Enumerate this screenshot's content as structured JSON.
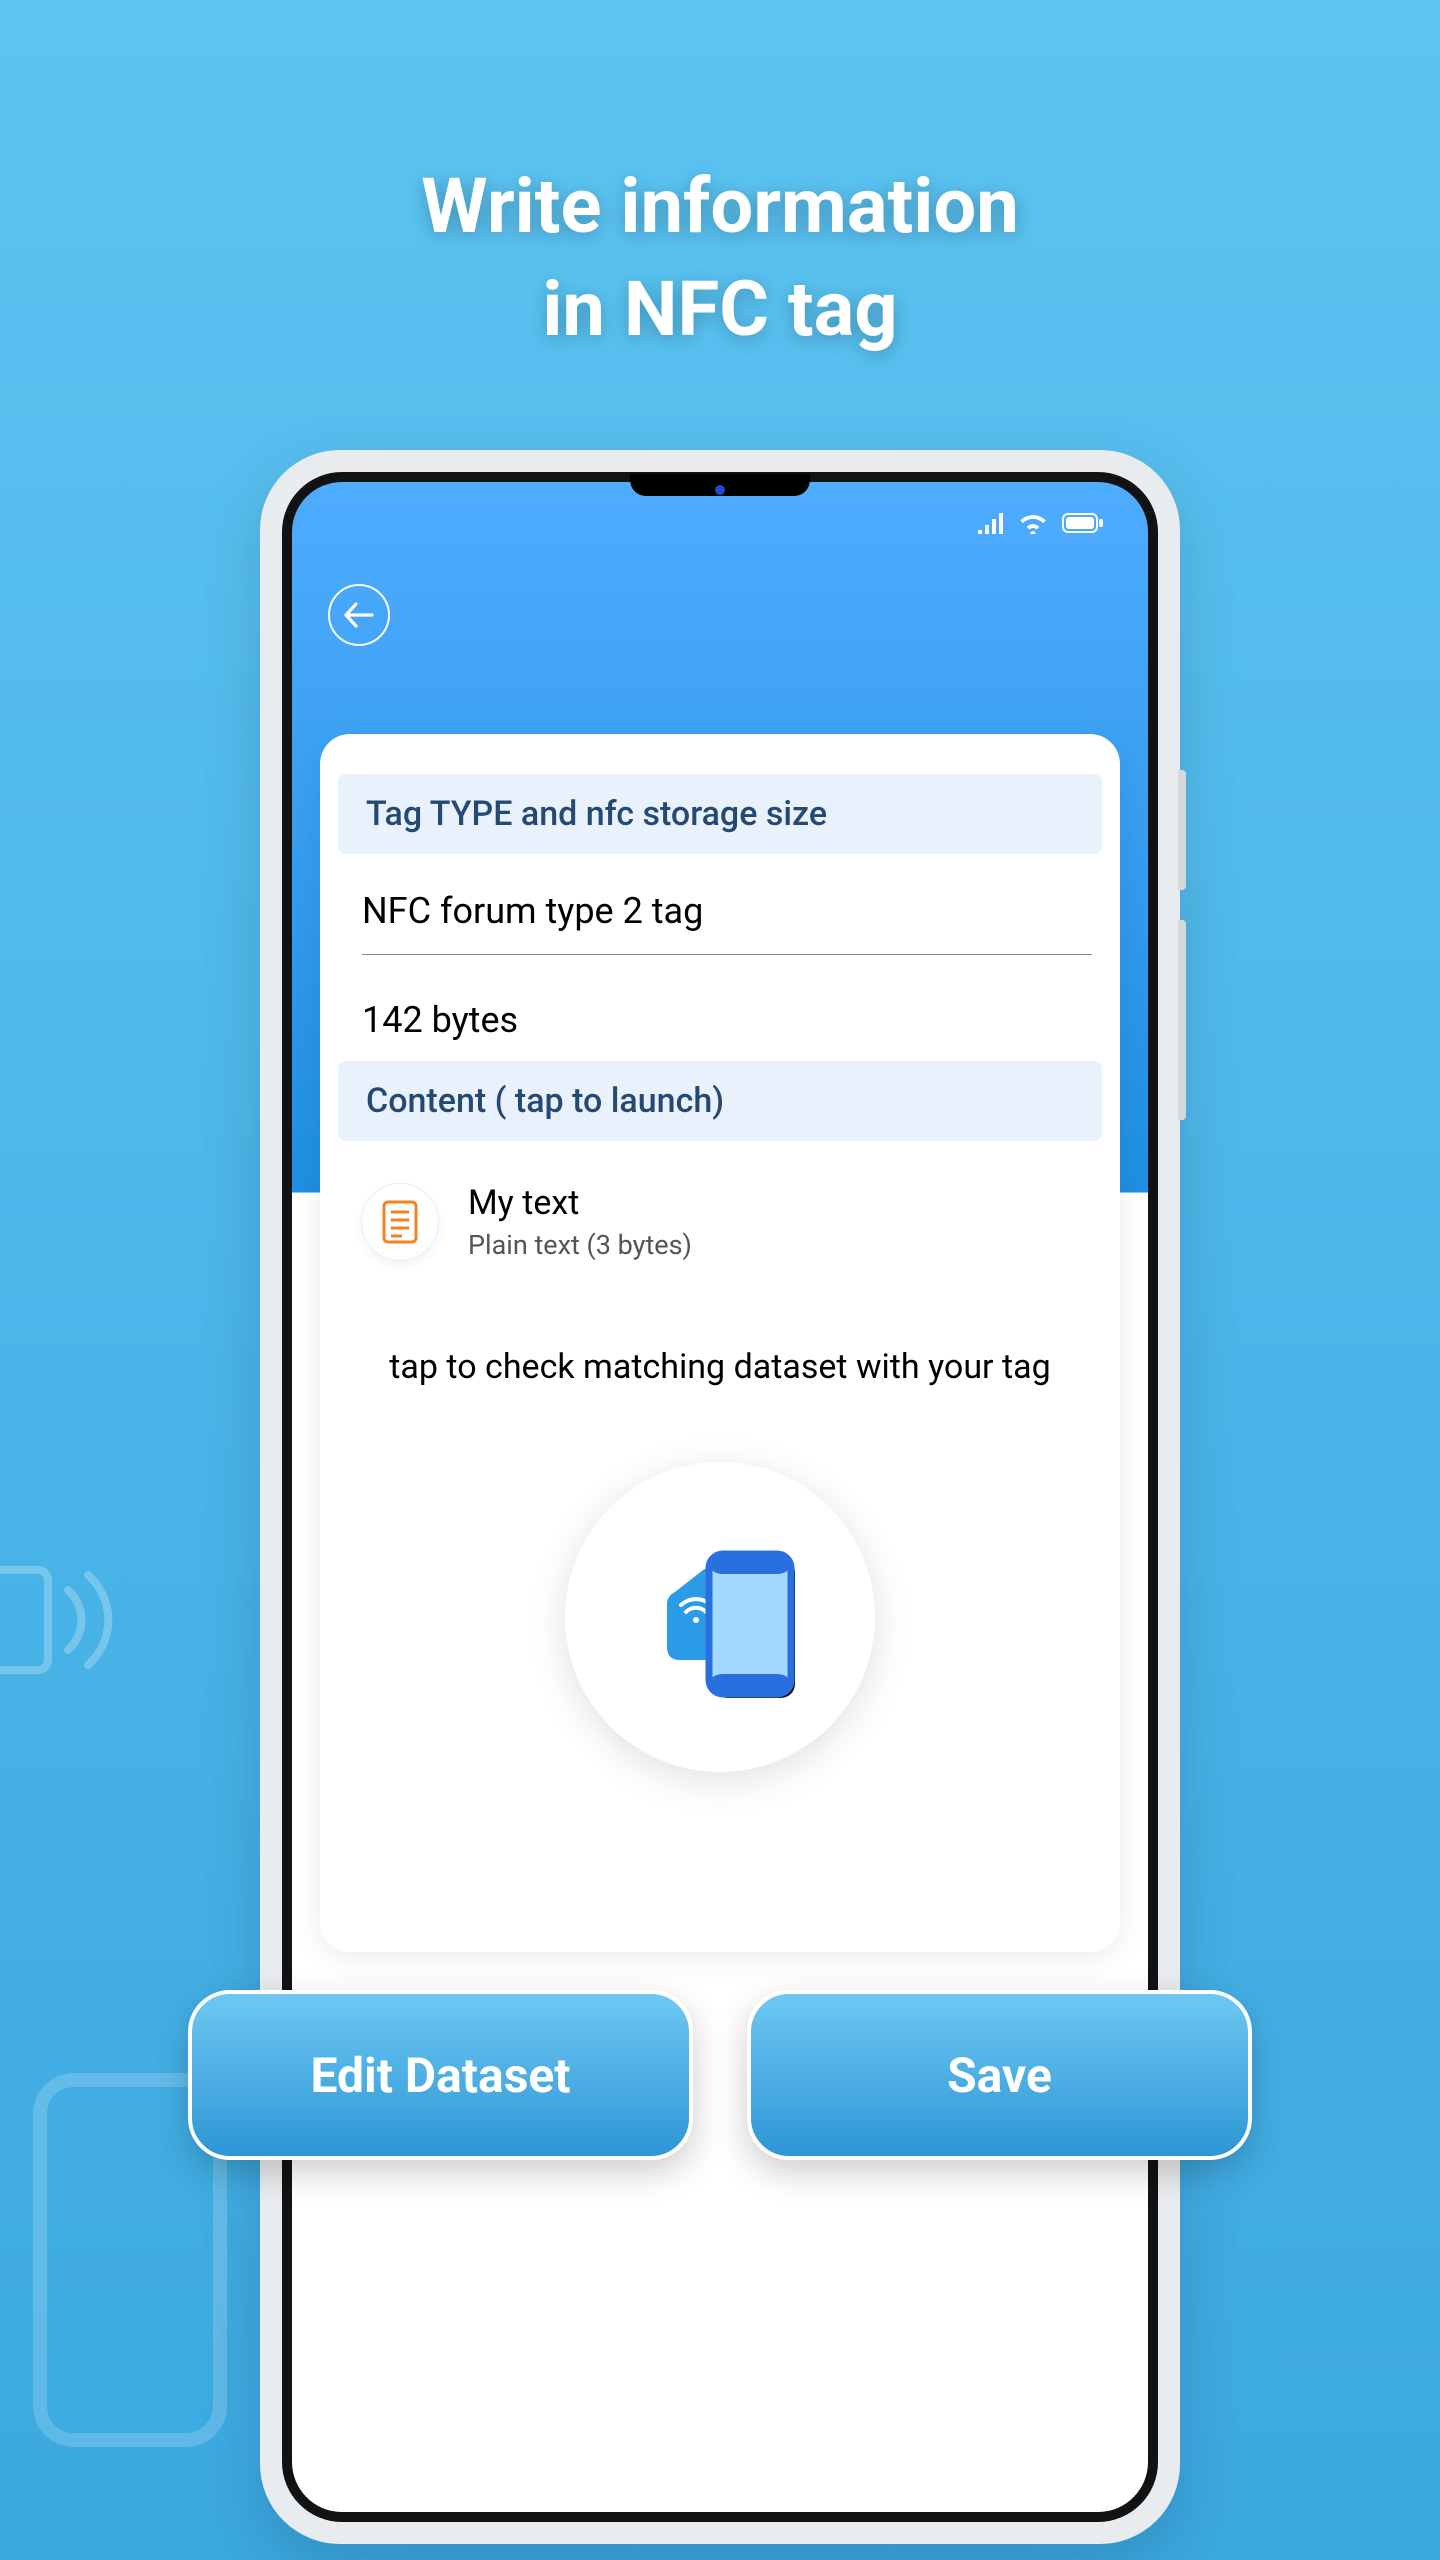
{
  "page": {
    "title_line1": "Write information",
    "title_line2": "in NFC tag"
  },
  "card": {
    "section_tag_type": "Tag TYPE and nfc storage size",
    "tag_type_value": "NFC forum type 2 tag",
    "storage_size": "142 bytes",
    "section_content": "Content ( tap to launch)",
    "item": {
      "title": "My text",
      "subtitle": "Plain text (3 bytes)"
    },
    "hint": "tap to check matching dataset with your tag"
  },
  "actions": {
    "edit": "Edit Dataset",
    "save": "Save"
  }
}
